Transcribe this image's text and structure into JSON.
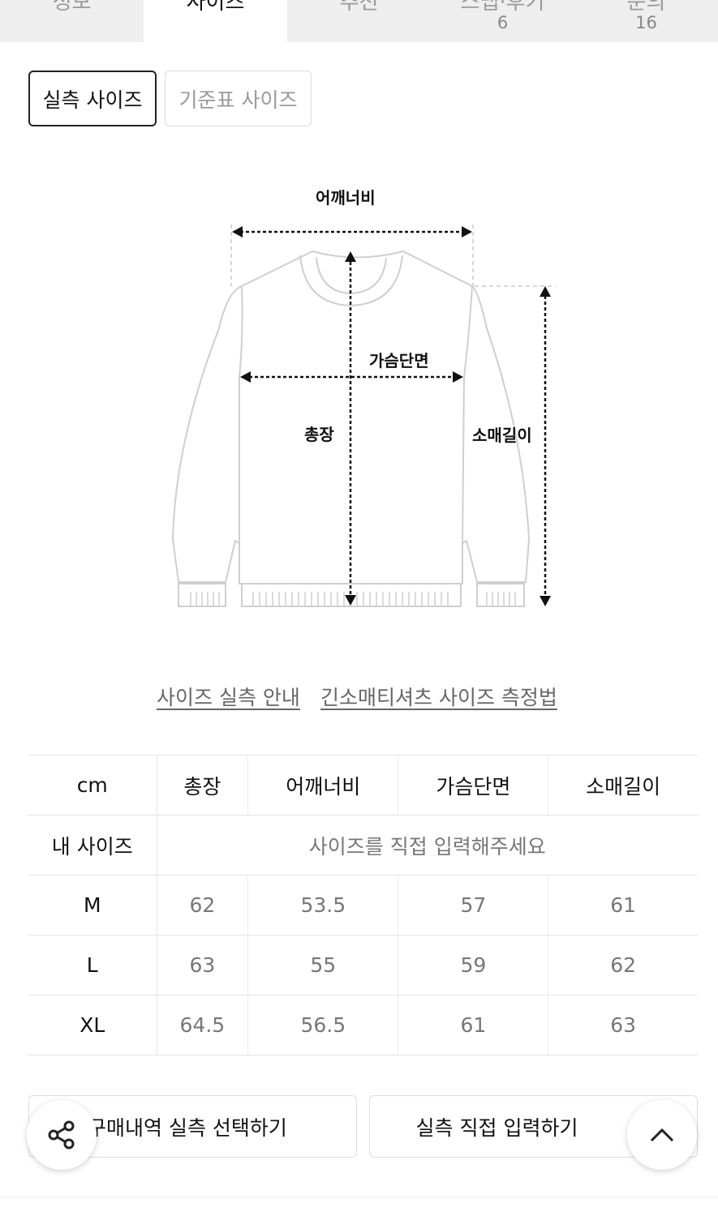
{
  "tabs": [
    {
      "label": "정보",
      "count": ""
    },
    {
      "label": "사이즈",
      "count": ""
    },
    {
      "label": "추천",
      "count": ""
    },
    {
      "label": "스냅·후기",
      "count": "6"
    },
    {
      "label": "문의",
      "count": "16"
    }
  ],
  "size_toggle": {
    "actual": "실측 사이즈",
    "standard": "기준표 사이즈"
  },
  "diagram": {
    "shoulder": "어깨너비",
    "chest": "가슴단면",
    "length": "총장",
    "sleeve": "소매길이"
  },
  "links": {
    "guide": "사이즈 실측 안내",
    "method": "긴소매티셔츠 사이즈 측정법"
  },
  "table": {
    "headers": [
      "cm",
      "총장",
      "어깨너비",
      "가슴단면",
      "소매길이"
    ],
    "my_size_label": "내 사이즈",
    "my_size_placeholder": "사이즈를 직접 입력해주세요",
    "rows": [
      {
        "size": "M",
        "values": [
          "62",
          "53.5",
          "57",
          "61"
        ]
      },
      {
        "size": "L",
        "values": [
          "63",
          "55",
          "59",
          "62"
        ]
      },
      {
        "size": "XL",
        "values": [
          "64.5",
          "56.5",
          "61",
          "63"
        ]
      }
    ]
  },
  "buttons": {
    "history": "구매내역 실측 선택하기",
    "direct": "실측 직접 입력하기"
  },
  "icons": {
    "share": "share-icon",
    "scroll_top": "chevron-up-icon"
  }
}
